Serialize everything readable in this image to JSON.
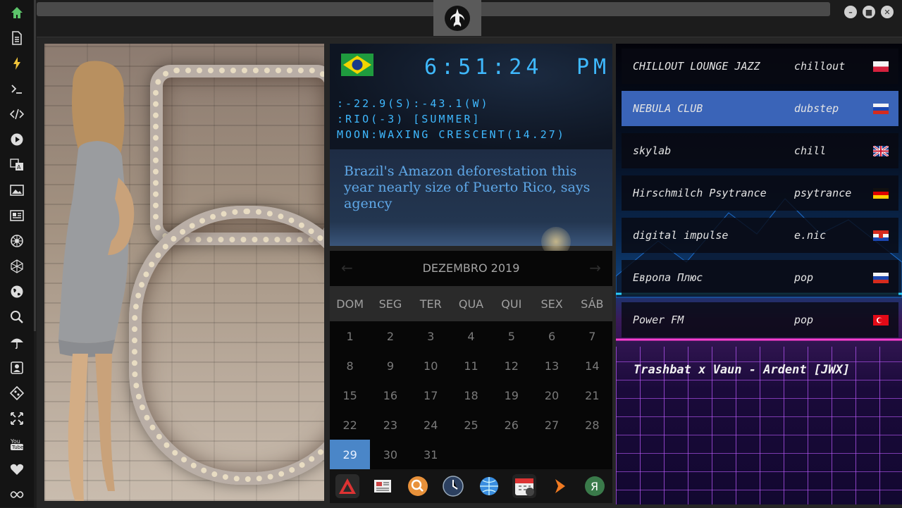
{
  "sidebar": {
    "icons": [
      "home-icon",
      "document-icon",
      "lightning-icon",
      "terminal-icon",
      "code-icon",
      "play-icon",
      "translate-icon",
      "image-icon",
      "news-icon",
      "settings-wheel-icon",
      "polygon-icon",
      "globe-icon",
      "search-icon",
      "umbrella-icon",
      "contact-card-icon",
      "git-icon",
      "fullscreen-icon",
      "youtube-icon",
      "heart-icon",
      "infinity-icon"
    ]
  },
  "clock": {
    "time": "6:51:24",
    "ampm": "PM",
    "coords": ":-22.9(S):-43.1(W)",
    "location": ":RIO(-3) [SUMMER]",
    "moon": "MOON:WAXING CRESCENT(14.27)"
  },
  "news": {
    "headline": "Brazil's Amazon deforestation this year nearly size of Puerto Rico, says agency"
  },
  "calendar": {
    "month_label": "DEZEMBRO 2019",
    "weekdays": [
      "DOM",
      "SEG",
      "TER",
      "QUA",
      "QUI",
      "SEX",
      "SÁB"
    ],
    "days": [
      "1",
      "2",
      "3",
      "4",
      "5",
      "6",
      "7",
      "8",
      "9",
      "10",
      "11",
      "12",
      "13",
      "14",
      "15",
      "16",
      "17",
      "18",
      "19",
      "20",
      "21",
      "22",
      "23",
      "24",
      "25",
      "26",
      "27",
      "28",
      "29",
      "30",
      "31"
    ],
    "today": "29"
  },
  "dock": {
    "icons": [
      "app-launcher-icon",
      "newspaper-icon",
      "search-icon",
      "clock-icon",
      "browser-icon",
      "calendar-icon",
      "arrow-icon",
      "yandex-icon"
    ]
  },
  "radio": {
    "stations": [
      {
        "name": "CHILLOUT LOUNGE JAZZ",
        "genre": "chillout",
        "flag": "pl"
      },
      {
        "name": "NEBULA CLUB",
        "genre": "dubstep",
        "flag": "ru"
      },
      {
        "name": "skylab",
        "genre": "chill",
        "flag": "gb"
      },
      {
        "name": "Hirschmilch Psytrance",
        "genre": "psytrance",
        "flag": "de"
      },
      {
        "name": "digital impulse",
        "genre": "e.nic",
        "flag": "hr"
      },
      {
        "name": "Европа Плюс",
        "genre": "pop",
        "flag": "ru"
      },
      {
        "name": "Power FM",
        "genre": "pop",
        "flag": "tr"
      }
    ],
    "active_index": 1,
    "now_playing": "Trashbat x Vaun - Ardent [JWX]"
  },
  "colors": {
    "lcd_blue": "#3fb9ff",
    "today_highlight": "#4a86c8",
    "active_station": "#3a64b8"
  }
}
